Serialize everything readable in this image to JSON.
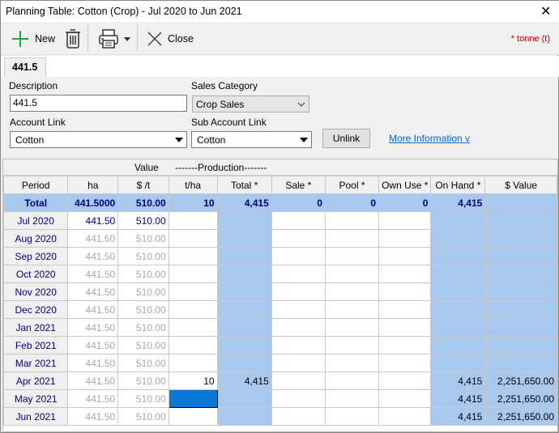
{
  "window": {
    "title": "Planning Table: Cotton (Crop) - Jul 2020 to Jun 2021"
  },
  "toolbar": {
    "new_label": "New",
    "close_label": "Close",
    "unit_note": "* tonne (t)"
  },
  "tab": {
    "label": "441.5"
  },
  "form": {
    "description_label": "Description",
    "description_value": "441.5",
    "sales_category_label": "Sales Category",
    "sales_category_value": "Crop Sales",
    "account_link_label": "Account Link",
    "account_link_value": "Cotton",
    "sub_account_link_label": "Sub Account Link",
    "sub_account_link_value": "Cotton",
    "unlink_label": "Unlink",
    "more_info_label": "More Information  v"
  },
  "grid": {
    "band": {
      "value": "Value",
      "production": "-------Production-------"
    },
    "columns": [
      "Period",
      "ha",
      "$ /t",
      "t/ha",
      "Total *",
      "Sale *",
      "Pool *",
      "Own Use *",
      "On Hand *",
      "$ Value"
    ],
    "total": [
      "Total",
      "441.5000",
      "510.00",
      "10",
      "4,415",
      "0",
      "0",
      "0",
      "4,415",
      ""
    ],
    "rows": [
      [
        "Jul 2020",
        "441.50",
        "510.00",
        "",
        "",
        "",
        "",
        "",
        "",
        ""
      ],
      [
        "Aug 2020",
        "441.50",
        "510.00",
        "",
        "",
        "",
        "",
        "",
        "",
        ""
      ],
      [
        "Sep 2020",
        "441.50",
        "510.00",
        "",
        "",
        "",
        "",
        "",
        "",
        ""
      ],
      [
        "Oct 2020",
        "441.50",
        "510.00",
        "",
        "",
        "",
        "",
        "",
        "",
        ""
      ],
      [
        "Nov 2020",
        "441.50",
        "510.00",
        "",
        "",
        "",
        "",
        "",
        "",
        ""
      ],
      [
        "Dec 2020",
        "441.50",
        "510.00",
        "",
        "",
        "",
        "",
        "",
        "",
        ""
      ],
      [
        "Jan 2021",
        "441.50",
        "510.00",
        "",
        "",
        "",
        "",
        "",
        "",
        ""
      ],
      [
        "Feb 2021",
        "441.50",
        "510.00",
        "",
        "",
        "",
        "",
        "",
        "",
        ""
      ],
      [
        "Mar 2021",
        "441.50",
        "510.00",
        "",
        "",
        "",
        "",
        "",
        "",
        ""
      ],
      [
        "Apr 2021",
        "441.50",
        "510.00",
        "10",
        "4,415",
        "",
        "",
        "",
        "4,415",
        "2,251,650.00"
      ],
      [
        "May 2021",
        "441.50",
        "510.00",
        "",
        "",
        "",
        "",
        "",
        "4,415",
        "2,251,650.00"
      ],
      [
        "Jun 2021",
        "441.50",
        "510.00",
        "",
        "",
        "",
        "",
        "",
        "4,415",
        "2,251,650.00"
      ]
    ],
    "selected_cell": {
      "row": "May 2021",
      "column": "t/ha"
    }
  },
  "colors": {
    "highlight": "#a8c8ee",
    "selection": "#0a78d7",
    "unit_note": "#c00000"
  }
}
